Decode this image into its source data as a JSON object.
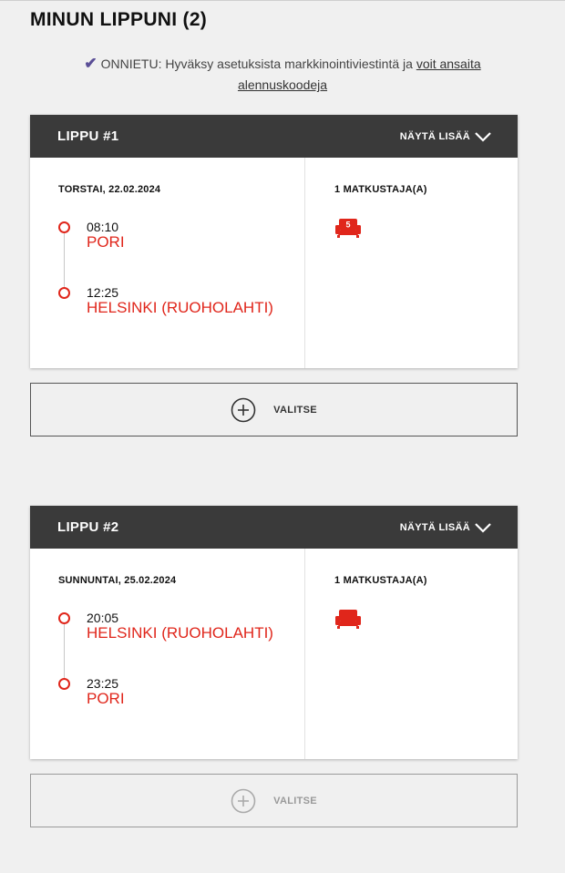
{
  "page": {
    "title": "MINUN LIPPUNI (2)"
  },
  "notice": {
    "prefix": "ONNIETU: Hyväksy asetuksista markkinointiviestintä ja ",
    "link": "voit ansaita alennuskoodeja"
  },
  "colors": {
    "accent": "#e0261b",
    "header": "#3a3a3a",
    "check": "#5a4e96"
  },
  "tickets": [
    {
      "title": "LIPPU #1",
      "show_more": "NÄYTÄ LISÄÄ",
      "date": "TORSTAI, 22.02.2024",
      "departure": {
        "time": "08:10",
        "city": "PORI"
      },
      "arrival": {
        "time": "12:25",
        "city": "HELSINKI (RUOHOLAHTI)"
      },
      "travellers": "1 MATKUSTAJA(A)",
      "seat_number": "5",
      "seat_icon": "seat-icon",
      "select_label": "VALITSE",
      "select_enabled": true
    },
    {
      "title": "LIPPU #2",
      "show_more": "NÄYTÄ LISÄÄ",
      "date": "SUNNUNTAI, 25.02.2024",
      "departure": {
        "time": "20:05",
        "city": "HELSINKI (RUOHOLAHTI)"
      },
      "arrival": {
        "time": "23:25",
        "city": "PORI"
      },
      "travellers": "1 MATKUSTAJA(A)",
      "seat_number": "",
      "seat_icon": "seat-icon",
      "select_label": "VALITSE",
      "select_enabled": false
    }
  ]
}
